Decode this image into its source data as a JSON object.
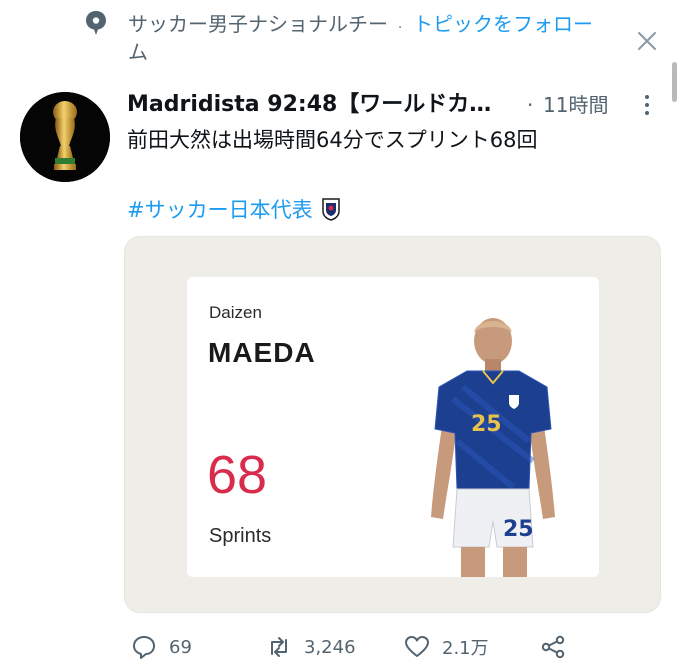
{
  "topic": {
    "name": "サッカー男子ナショナルチーム",
    "separator": "·",
    "follow_label": "トピックをフォロー",
    "icon": "topic-bubble-icon",
    "close_icon": "close-icon"
  },
  "tweet": {
    "author_name": "Madridista 92:48【ワールドカ…",
    "separator": "·",
    "time": "11時間",
    "text": "前田大然は出場時間64分でスプリント68回",
    "hashtag": "#サッカー日本代表",
    "hashtag_emoji": "japan-emblem-icon",
    "avatar": "world-cup-trophy-avatar"
  },
  "media": {
    "first_name": "Daizen",
    "last_name": "MAEDA",
    "stat_value": "68",
    "stat_label": "Sprints",
    "jersey_number": "25",
    "accent": "#d92b4b",
    "kit_color": "#1c3f8f"
  },
  "actions": {
    "reply": {
      "icon": "reply-icon",
      "count": "69"
    },
    "retweet": {
      "icon": "retweet-icon",
      "count": "3,246"
    },
    "like": {
      "icon": "heart-icon",
      "count": "2.1万"
    },
    "share": {
      "icon": "share-icon"
    }
  },
  "colors": {
    "link": "#1d9bf0",
    "secondary_text": "#536471",
    "card_background": "#eeede7"
  }
}
